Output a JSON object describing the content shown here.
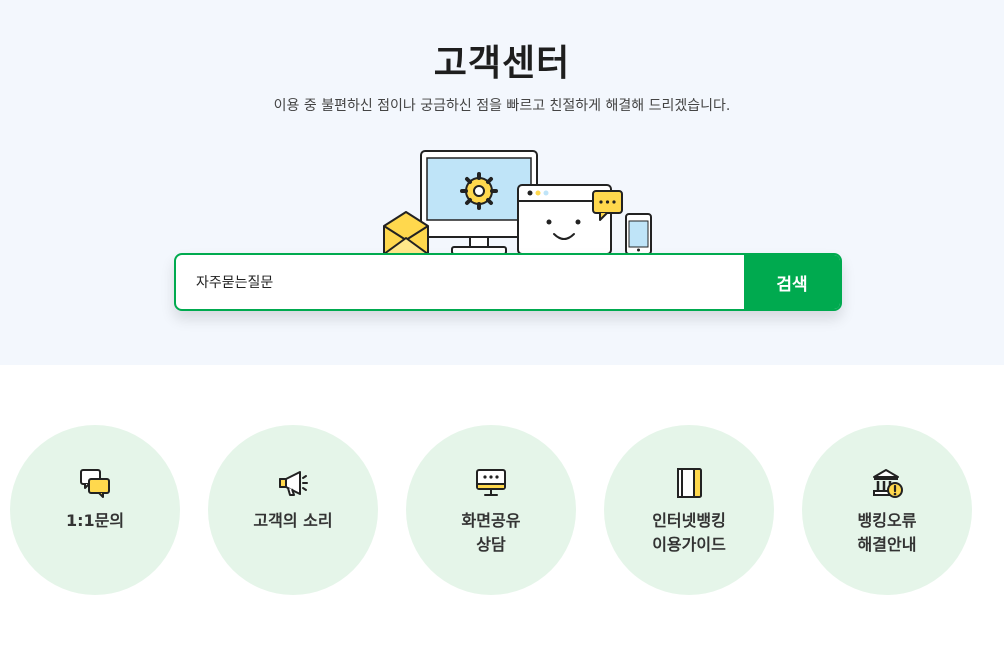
{
  "hero": {
    "title": "고객센터",
    "subtitle": "이용 중 불편하신 점이나 궁금하신 점을 빠르고 친절하게 해결해 드리겠습니다."
  },
  "search": {
    "value": "자주묻는질문",
    "button_label": "검색"
  },
  "services": [
    {
      "label": "1:1문의",
      "icon": "chat-bubbles-icon"
    },
    {
      "label": "고객의 소리",
      "icon": "megaphone-icon"
    },
    {
      "label": "화면공유\n상담",
      "icon": "monitor-share-icon"
    },
    {
      "label": "인터넷뱅킹\n이용가이드",
      "icon": "guide-book-icon"
    },
    {
      "label": "뱅킹오류\n해결안내",
      "icon": "bank-alert-icon"
    }
  ],
  "colors": {
    "accent": "#00aa4f",
    "hero_bg": "#f3f7fd",
    "circle_bg": "#e5f5e9",
    "highlight": "#ffd84d"
  }
}
